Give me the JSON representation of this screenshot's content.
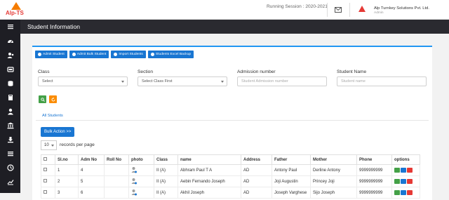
{
  "brand": {
    "logo_text": "Alp-TS"
  },
  "header": {
    "session_label": "Running Session : 2020-2021",
    "company_name": "Alp Turnkey Solutions Pvt. Ltd.",
    "company_role": "Admin"
  },
  "sidebar": {
    "items": [
      {
        "icon": "menu-icon"
      },
      {
        "icon": "dashboard-icon"
      },
      {
        "icon": "users-icon"
      },
      {
        "icon": "id-card-icon"
      },
      {
        "icon": "database-icon"
      },
      {
        "icon": "book-icon"
      },
      {
        "icon": "user-icon"
      },
      {
        "icon": "bank-icon"
      },
      {
        "icon": "download-icon"
      },
      {
        "icon": "list-icon"
      },
      {
        "icon": "clock-icon"
      },
      {
        "icon": "chart-icon"
      }
    ]
  },
  "page": {
    "title": "Student Information"
  },
  "toolbar": {
    "admit_student": "Admit Student",
    "admit_bulk": "Admit Bulk Student",
    "import_students": "Import Students",
    "excel_backup": "Students Excel Backup"
  },
  "filters": {
    "class_label": "Class",
    "class_value": "Select",
    "section_label": "Section",
    "section_value": "Select Class First",
    "admission_label": "Admission number",
    "admission_placeholder": "Student Admission number",
    "name_label": "Student Name",
    "name_placeholder": "Student name"
  },
  "tabs": {
    "all_students": "All Students"
  },
  "list": {
    "bulk_action": "Bulk Action >>",
    "per_page_value": "10",
    "per_page_label": "records per page"
  },
  "table": {
    "columns": [
      "Sl.no",
      "Adm No",
      "Roll No",
      "photo",
      "Class",
      "name",
      "Address",
      "Father",
      "Mother",
      "Phone",
      "options"
    ],
    "rows": [
      {
        "sl": "1",
        "adm": "4",
        "roll": "",
        "class": "II (A)",
        "name": "Abhram Paul T A",
        "address": "AD",
        "father": "Antony Paul",
        "mother": "Derline Antony",
        "phone": "9999999999"
      },
      {
        "sl": "2",
        "adm": "5",
        "roll": "",
        "class": "II (A)",
        "name": "Aebin Fernando Joseph",
        "address": "AD",
        "father": "Joji Augustin",
        "mother": "Princey Joji",
        "phone": "9999999999"
      },
      {
        "sl": "3",
        "adm": "6",
        "roll": "",
        "class": "II (A)",
        "name": "Akhil Joseph",
        "address": "AD",
        "father": "Joseph Varghese",
        "mother": "Sijo Joseph",
        "phone": "9999999999"
      }
    ]
  },
  "colors": {
    "primary": "#1976d2",
    "sidebar": "#1e1e24",
    "titlebar": "#2a2a30",
    "search": "#43a047",
    "reset": "#fb8c00",
    "delete": "#e53935"
  }
}
